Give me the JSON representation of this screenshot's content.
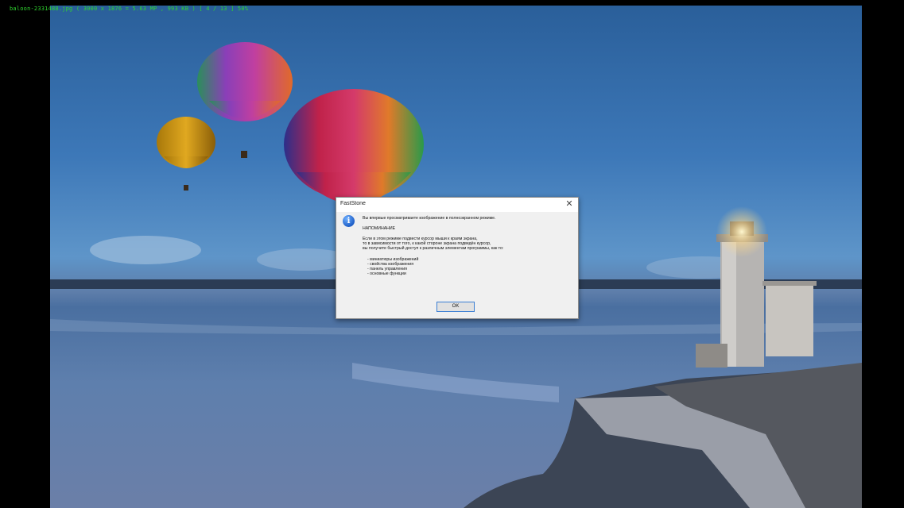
{
  "viewer": {
    "status_text": "baloon-2331488.jpg  ( 3000 x 1876 = 5.63 MP  ,  993 KB )  [ 4 / 13 ]   50%"
  },
  "dialog": {
    "title": "FastStone",
    "close_glyph": "✕",
    "icon": "info-icon",
    "message_line1": "Вы впервые просматриваете изображение в полноэкранном режиме.",
    "heading": "НАПОМИНАНИЕ",
    "para_line1": "Если в этом режиме подвести курсор мыши к краям экрана,",
    "para_line2": "то в зависимости от того, к какой стороне экрана подведён курсор,",
    "para_line3": "вы получите быстрый доступ к различным элементам программы, как то:",
    "list": [
      "- миниатюры изображений",
      "- свойства изображения",
      "- панель управления",
      "- основные функции"
    ],
    "ok_label": "OK"
  },
  "colors": {
    "status_green": "#2fd62f",
    "accent_blue": "#3c7fd4"
  }
}
